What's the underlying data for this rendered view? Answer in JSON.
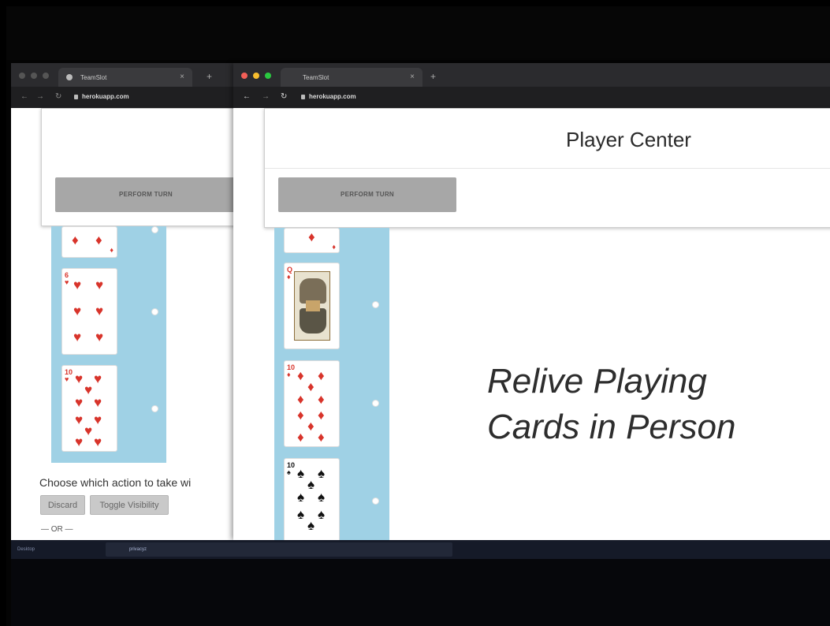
{
  "back_window": {
    "tab_title": "TeamSlot",
    "url": "herokuapp.com",
    "perform_turn_label": "PERFORM TURN",
    "choose_text": "Choose which action to take wi",
    "discard_label": "Discard",
    "toggle_visibility_label": "Toggle Visibility",
    "or_text": "— OR —"
  },
  "front_window": {
    "tab_title": "TeamSlot",
    "url": "herokuapp.com",
    "header_title": "Player Center",
    "perform_turn_label": "PERFORM TURN",
    "tagline_line1": "Relive Playing",
    "tagline_line2": "Cards in Person"
  },
  "taskbar": {
    "left_label": "Desktop",
    "folder_label": "privacyz"
  },
  "colors": {
    "hand_bg": "#9fd1e5",
    "button_bg": "#a7a7a7",
    "red_suit": "#d8342b"
  },
  "icons": [
    "reload-icon",
    "lock-icon",
    "back-arrow-icon",
    "forward-arrow-icon",
    "close-tab-icon",
    "new-tab-icon",
    "diamond-suit-icon",
    "heart-suit-icon",
    "spade-suit-icon",
    "radio-icon"
  ]
}
